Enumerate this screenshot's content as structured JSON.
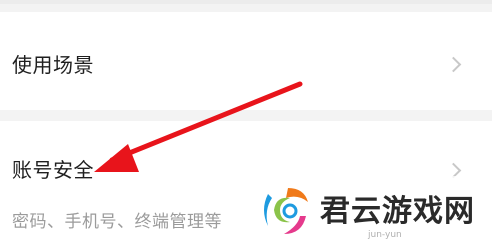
{
  "settings": {
    "scene_item": {
      "label": "使用场景"
    },
    "account_item": {
      "label": "账号安全",
      "description": "密码、手机号、终端管理等"
    }
  },
  "annotation": {
    "arrow_color": "#e8141b"
  },
  "watermark": {
    "brand": "君云游戏网",
    "sub": "jun-yun"
  },
  "icons": {
    "chevron": "chevron-right-icon",
    "logo": "watermark-logo-icon"
  }
}
